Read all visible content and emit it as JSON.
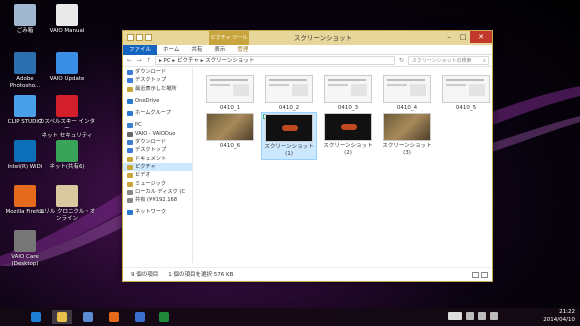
{
  "desktop_icons": [
    {
      "label": "ごみ箱",
      "icon": "recycle-bin-icon",
      "color": "#9fb8d0"
    },
    {
      "label": "VAIO Manual",
      "icon": "vaio-manual-icon",
      "color": "#e9e9e9"
    },
    {
      "label": "Adobe\nPhotosho...",
      "icon": "photoshop-icon",
      "color": "#2b6fb0"
    },
    {
      "label": "VAIO Update",
      "icon": "vaio-update-icon",
      "color": "#3a8ee6"
    },
    {
      "label": "CLIP STUDIO",
      "icon": "clip-studio-icon",
      "color": "#4aa0e8"
    },
    {
      "label": "カスペルスキー インター\nネット セキュリティ",
      "icon": "kaspersky-icon",
      "color": "#d21f2b"
    },
    {
      "label": "Intel(R) WiDi",
      "icon": "intel-widi-icon",
      "color": "#0d6fb8"
    },
    {
      "label": "ネット(共有6)",
      "icon": "net-share-icon",
      "color": "#3aa35a"
    },
    {
      "label": "Mozilla Firefox",
      "icon": "firefox-icon",
      "color": "#e66a1b"
    },
    {
      "label": "エリル クロニクル・オ\nンライン",
      "icon": "game-icon",
      "color": "#d9c9a0"
    },
    {
      "label": "VAIO Care\n(Desktop)",
      "icon": "vaio-care-icon",
      "color": "#777"
    }
  ],
  "window": {
    "title": "スクリーンショット",
    "context_tab": "ピクチャ ツール",
    "ribbon_tabs": [
      "ファイル",
      "ホーム",
      "共有",
      "表示",
      "管理"
    ],
    "address_path": "▸ PC ▸ ピクチャ ▸ スクリーンショット",
    "search_placeholder": "スクリーンショットの検索",
    "min_label": "–",
    "max_label": "□",
    "close_label": "✕"
  },
  "nav_pane": [
    {
      "label": "ダウンロード",
      "icon": "downloads-icon",
      "color": "#3d7dd6"
    },
    {
      "label": "デスクトップ",
      "icon": "desktop-icon",
      "color": "#3d7dd6"
    },
    {
      "label": "最近表示した場所",
      "icon": "recent-icon",
      "color": "#c9a63d"
    },
    {
      "gap": true
    },
    {
      "label": "OneDrive",
      "icon": "onedrive-icon",
      "color": "#2a79d0"
    },
    {
      "gap": true
    },
    {
      "label": "ホームグループ",
      "icon": "homegroup-icon",
      "color": "#2a79d0"
    },
    {
      "gap": true
    },
    {
      "label": "PC",
      "icon": "pc-icon",
      "color": "#3b7fd1"
    },
    {
      "label": "VAIO - VAIODuo",
      "icon": "phone-icon",
      "color": "#666"
    },
    {
      "label": "ダウンロード",
      "icon": "downloads-icon",
      "color": "#3d7dd6"
    },
    {
      "label": "デスクトップ",
      "icon": "desktop-icon",
      "color": "#3d7dd6"
    },
    {
      "label": "ドキュメント",
      "icon": "documents-icon",
      "color": "#c9a63d"
    },
    {
      "label": "ピクチャ",
      "icon": "pictures-icon",
      "color": "#c9a63d",
      "selected": true
    },
    {
      "label": "ビデオ",
      "icon": "videos-icon",
      "color": "#c9a63d"
    },
    {
      "label": "ミュージック",
      "icon": "music-icon",
      "color": "#c9a63d"
    },
    {
      "label": "ローカル ディスク (C",
      "icon": "disk-icon",
      "color": "#888"
    },
    {
      "label": "共有 (¥¥192.168",
      "icon": "network-drive-icon",
      "color": "#888"
    },
    {
      "gap": true
    },
    {
      "label": "ネットワーク",
      "icon": "network-icon",
      "color": "#2a79d0"
    }
  ],
  "files": [
    {
      "caption": "0410_1",
      "thumb": "doc"
    },
    {
      "caption": "0410_2",
      "thumb": "doc"
    },
    {
      "caption": "0410_3",
      "thumb": "doc"
    },
    {
      "caption": "0410_4",
      "thumb": "doc"
    },
    {
      "caption": "0410_5",
      "thumb": "doc"
    },
    {
      "caption": "0410_6",
      "thumb": "game"
    },
    {
      "caption": "スクリーンショット\n(1)",
      "thumb": "dark",
      "selected": true
    },
    {
      "caption": "スクリーンショット\n(2)",
      "thumb": "dark"
    },
    {
      "caption": "スクリーンショット\n(3)",
      "thumb": "game"
    }
  ],
  "status_bar": {
    "item_count": "9 個の項目",
    "selection": "1 個の項目を選択 576 KB"
  },
  "taskbar": {
    "time": "21:22",
    "date": "2014/04/10",
    "items": [
      "ie-icon",
      "explorer-icon",
      "people-icon",
      "firefox-icon",
      "shield-icon",
      "excel-icon"
    ]
  }
}
